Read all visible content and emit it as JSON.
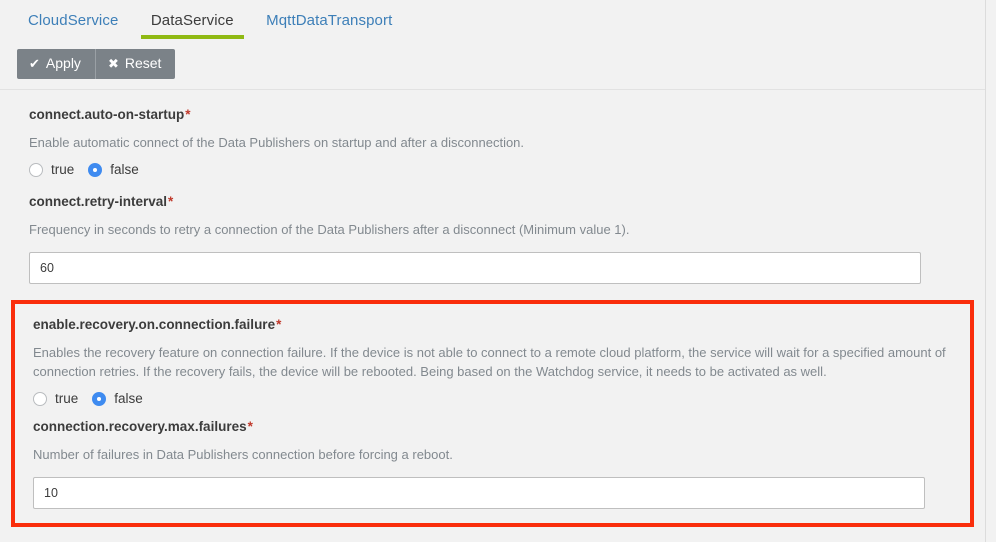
{
  "tabs": [
    {
      "label": "CloudService",
      "active": false
    },
    {
      "label": "DataService",
      "active": true
    },
    {
      "label": "MqttDataTransport",
      "active": false
    }
  ],
  "toolbar": {
    "apply_label": "Apply",
    "apply_glyph": "✔",
    "reset_label": "Reset",
    "reset_glyph": "✖"
  },
  "colors": {
    "active_tab_underline": "#8fb913",
    "tab_link": "#3d7fb8",
    "button_bg": "#7b8288",
    "radio_selected": "#3f8bf0",
    "required_asterisk": "#c0392b",
    "highlight_border": "#fa2e0c",
    "page_bg": "#f2f2f2"
  },
  "fields": [
    {
      "name": "connect.auto-on-startup",
      "required_mark": "*",
      "description": "Enable automatic connect of the Data Publishers on startup and after a disconnection.",
      "type": "radio",
      "options": [
        {
          "label": "true",
          "selected": false
        },
        {
          "label": "false",
          "selected": true
        }
      ]
    },
    {
      "name": "connect.retry-interval",
      "required_mark": "*",
      "description": "Frequency in seconds to retry a connection of the Data Publishers after a disconnect (Minimum value 1).",
      "type": "text",
      "value": "60",
      "placeholder": ""
    }
  ],
  "highlighted_fields": [
    {
      "name": "enable.recovery.on.connection.failure",
      "required_mark": "*",
      "description": "Enables the recovery feature on connection failure. If the device is not able to connect to a remote cloud platform, the service will wait for a specified amount of connection retries. If the recovery fails, the device will be rebooted. Being based on the Watchdog service, it needs to be activated as well.",
      "type": "radio",
      "options": [
        {
          "label": "true",
          "selected": false
        },
        {
          "label": "false",
          "selected": true
        }
      ]
    },
    {
      "name": "connection.recovery.max.failures",
      "required_mark": "*",
      "description": "Number of failures in Data Publishers connection before forcing a reboot.",
      "type": "text",
      "value": "10",
      "placeholder": ""
    }
  ]
}
